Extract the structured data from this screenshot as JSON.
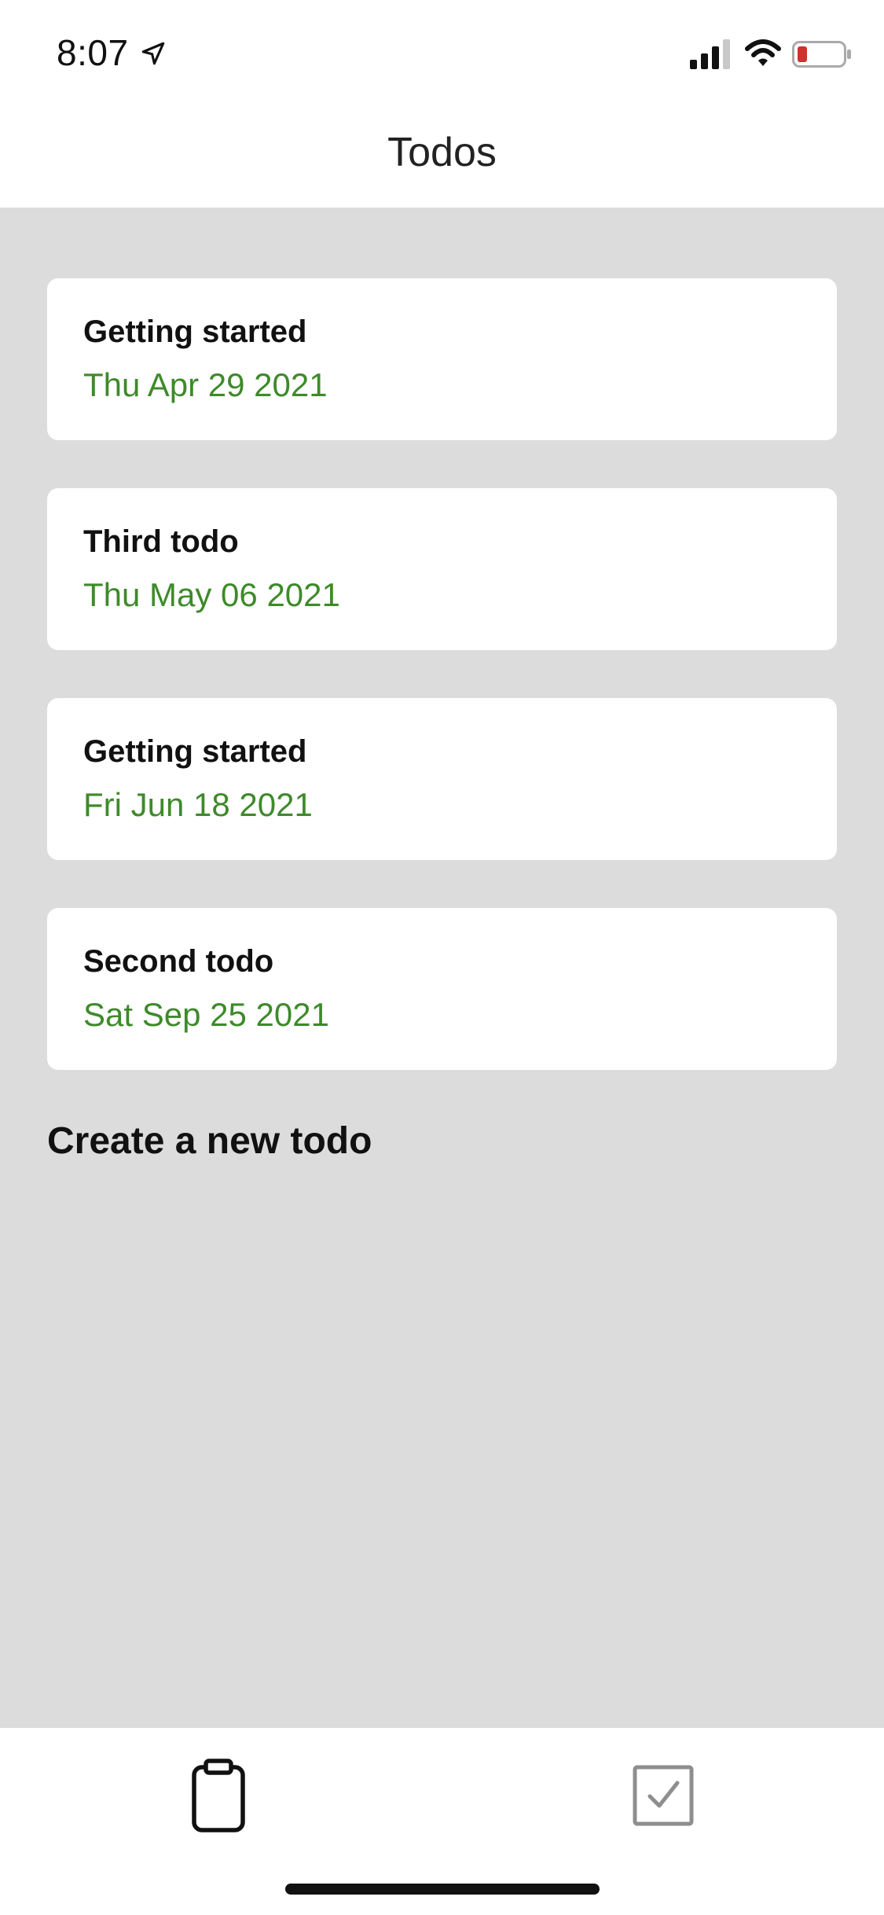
{
  "status_bar": {
    "time": "8:07",
    "icons": [
      "location-icon",
      "signal-icon",
      "wifi-icon",
      "battery-icon"
    ],
    "battery_color": "#d0312d"
  },
  "nav": {
    "title": "Todos"
  },
  "todos": [
    {
      "title": "Getting started",
      "date": "Thu Apr 29 2021"
    },
    {
      "title": "Third todo",
      "date": "Thu May 06 2021"
    },
    {
      "title": "Getting started",
      "date": "Fri Jun 18 2021"
    },
    {
      "title": "Second todo",
      "date": "Sat Sep 25 2021"
    }
  ],
  "create_label": "Create a new todo",
  "tabs": [
    {
      "icon": "clipboard-icon",
      "active": true
    },
    {
      "icon": "checkbox-icon",
      "active": false
    }
  ],
  "colors": {
    "date_green": "#3e8a2a",
    "background": "#dcdcdc",
    "card": "#ffffff"
  }
}
